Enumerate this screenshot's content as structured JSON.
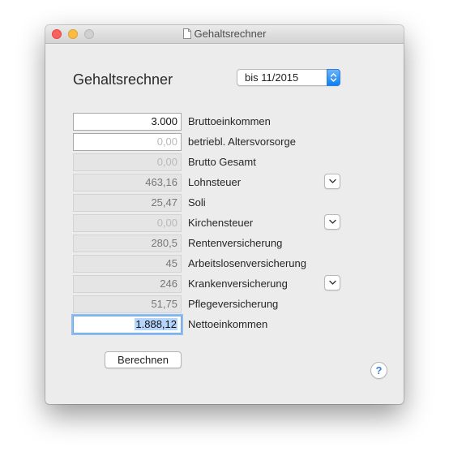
{
  "window": {
    "title": "Gehaltsrechner"
  },
  "form": {
    "heading": "Gehaltsrechner",
    "period_select": {
      "selected": "bis 11/2015"
    },
    "rows": [
      {
        "value": "3.000",
        "label": "Bruttoeinkommen"
      },
      {
        "value": "0,00",
        "label": "betriebl. Altersvorsorge"
      },
      {
        "value": "0,00",
        "label": "Brutto Gesamt"
      },
      {
        "value": "463,16",
        "label": "Lohnsteuer"
      },
      {
        "value": "25,47",
        "label": "Soli"
      },
      {
        "value": "0,00",
        "label": "Kirchensteuer"
      },
      {
        "value": "280,5",
        "label": "Rentenversicherung"
      },
      {
        "value": "45",
        "label": "Arbeitslosenversicherung"
      },
      {
        "value": "246",
        "label": "Krankenversicherung"
      },
      {
        "value": "51,75",
        "label": "Pflegeversicherung"
      },
      {
        "value": "1.888,12",
        "label": "Nettoeinkommen"
      }
    ],
    "calculate_label": "Berechnen",
    "help_label": "?"
  },
  "icons": {
    "title_icon": "document-icon",
    "disclosure_icon": "chevron-down-icon",
    "popup_icon": "up-down-arrows-icon"
  },
  "colors": {
    "accent": "#1a82f7",
    "close": "#fc605c",
    "minimize": "#fdbc40",
    "selection": "#b5d5fd"
  }
}
